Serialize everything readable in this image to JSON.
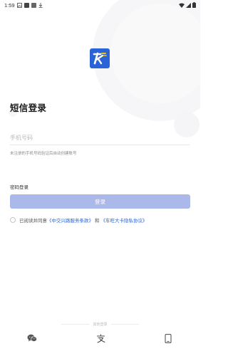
{
  "status_bar": {
    "time": "1:59"
  },
  "header": {
    "title": "短信登录"
  },
  "form": {
    "phone_placeholder": "手机号码",
    "phone_value": "",
    "hint": "未注册的手机号码验证后自动创建账号",
    "password_login_label": "密码登录",
    "login_button_label": "登录"
  },
  "agreement": {
    "prefix": "已阅读并同意",
    "terms_link": "《中交兴路服务条款》",
    "and": "和",
    "privacy_link": "《车旺大卡隐私协议》"
  },
  "other_login": {
    "label": "其他登录",
    "icons": [
      "wechat-icon",
      "alipay-icon",
      "phone-device-icon"
    ]
  },
  "colors": {
    "brand": "#2a63d8",
    "button_disabled": "#abb9ea"
  }
}
